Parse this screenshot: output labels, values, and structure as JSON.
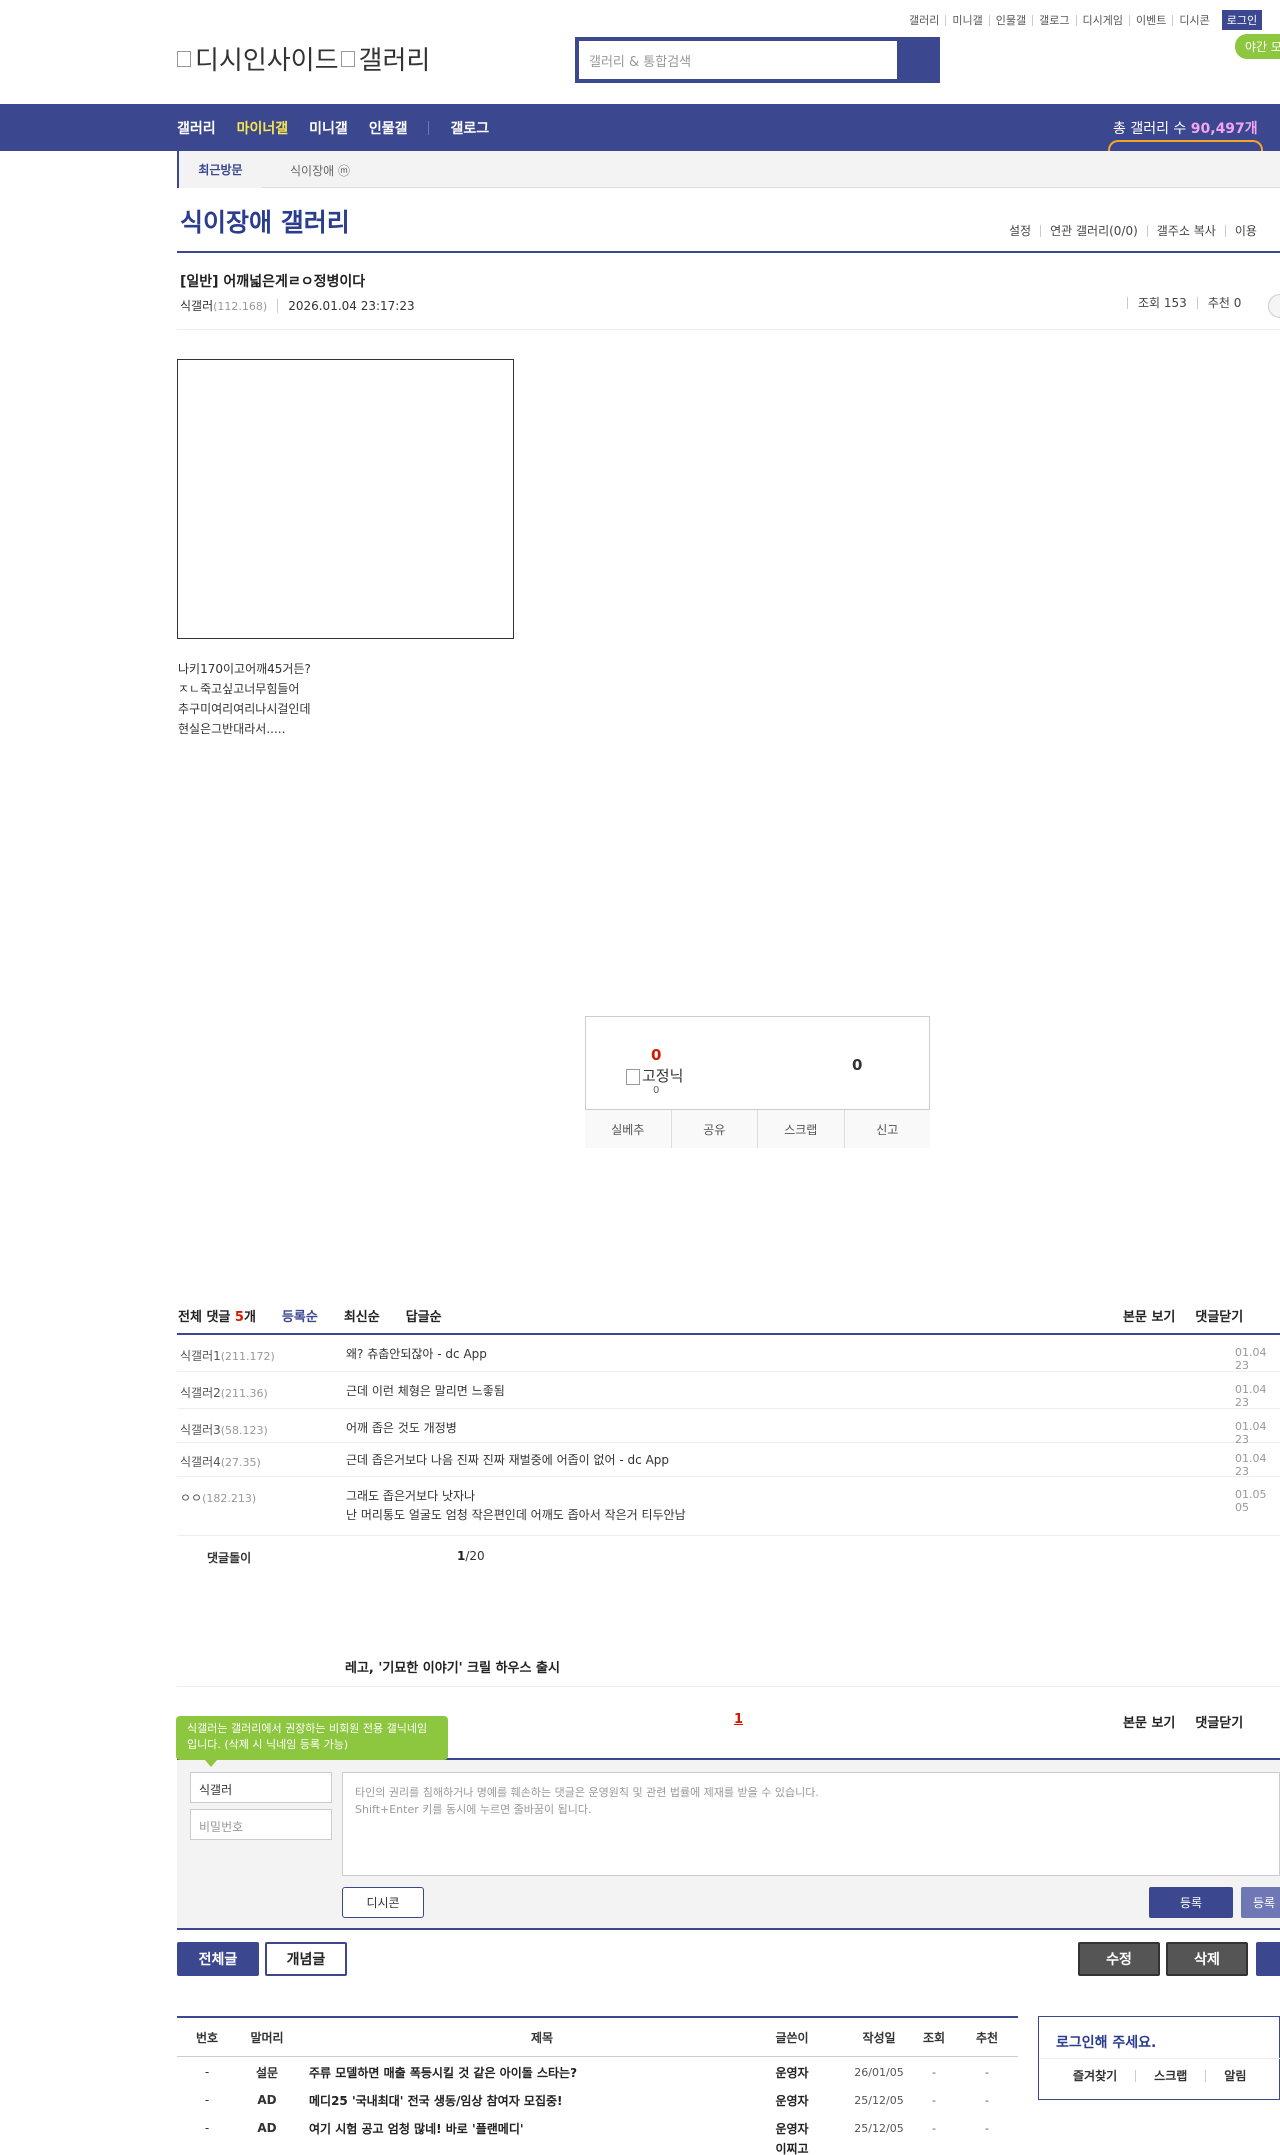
{
  "util_links": [
    "갤러리",
    "미니갤",
    "인물갤",
    "갤로그",
    "디시게임",
    "이벤트",
    "디시콘"
  ],
  "login_label": "로그인",
  "night_mode_label": "야간 모",
  "logo": {
    "part1": "디시인사이드",
    "part2": "갤러리"
  },
  "search": {
    "placeholder": "갤러리 & 통합검색"
  },
  "gnb": {
    "items": [
      "갤러리",
      "마이너갤",
      "미니갤",
      "인물갤",
      "갤로그"
    ],
    "active": "마이너갤"
  },
  "gall_count": {
    "label": "총 갤러리 수 ",
    "value": "90,497개"
  },
  "recent": {
    "tab": "최근방문",
    "item": "식이장애 ⓜ"
  },
  "gallery": {
    "title": "식이장애 갤러리",
    "links": [
      "설정",
      "연관 갤러리(0/0)",
      "갤주소 복사",
      "이용"
    ]
  },
  "post": {
    "subject": "[일반] 어깨넓은게ㄹㅇ정병이다",
    "writer": "식갤러",
    "ip": "(112.168)",
    "date": "2026.01.04 23:17:23",
    "views": "조회 153",
    "recommends": "추천 0",
    "body": [
      "나키170이고어깨45거든?",
      "ㅈㄴ죽고싶고너무힘들어",
      "추구미여리여리나시걸인데",
      "현실은그반대라서....."
    ]
  },
  "reco": {
    "up": "0",
    "fixed_label": "고정닉",
    "fixed_count": "0",
    "down": "0",
    "actions": [
      "실베추",
      "공유",
      "스크랩",
      "신고"
    ]
  },
  "comments": {
    "total_label": "전체 댓글 ",
    "total_count": "5",
    "total_unit": "개",
    "tabs": [
      "등록순",
      "최신순",
      "답글순"
    ],
    "right": [
      "본문 보기",
      "댓글닫기"
    ],
    "items": [
      {
        "name": "식갤러1",
        "ip": "(211.172)",
        "text": "왜? 츄춥안되잖아 - dc App",
        "date": "01.04 23"
      },
      {
        "name": "식갤러2",
        "ip": "(211.36)",
        "text": "근데 이런 체형은 말리면 느좋됨",
        "date": "01.04 23"
      },
      {
        "name": "식갤러3",
        "ip": "(58.123)",
        "text": "어깨 좁은 것도 개정병",
        "date": "01.04 23"
      },
      {
        "name": "식갤러4",
        "ip": "(27.35)",
        "text": "근데 좁은거보다 나음 진짜 진짜 재벌중에 어좁이 없어 - dc App",
        "date": "01.04 23"
      },
      {
        "name": "ㅇㅇ",
        "ip": "(182.213)",
        "text": "그래도 좁은거보다 낫자나",
        "text2": "난 머리통도 얼굴도 엄청 작은편인데 어깨도 좁아서 작은거 티두안남",
        "date": "01.05 05"
      }
    ],
    "dolgi": "댓글돌이",
    "page_current": "1",
    "page_total": "/20"
  },
  "ad_text": "레고, '기묘한 이야기' 크릴 하우스 출시",
  "pager_current": "1",
  "write": {
    "tooltip": "식갤러는 갤러리에서 권장하는 비회원 전용 갤닉네임입니다. (삭제 시 닉네임 등록 가능)",
    "nick": "식갤러",
    "pw_placeholder": "비밀번호",
    "notice1": "타인의 권리를 침해하거나 명예를 훼손하는 댓글은 운영원칙 및 관련 법률에 제재를 받을 수 있습니다.",
    "notice2": "Shift+Enter 키를 동시에 누르면 줄바꿈이 됩니다.",
    "dccon": "디시콘",
    "register": "등록",
    "register2": "등록"
  },
  "bottom_buttons": {
    "all": "전체글",
    "concept": "개념글",
    "edit": "수정",
    "delete": "삭제"
  },
  "list": {
    "headers": [
      "번호",
      "말머리",
      "제목",
      "글쓴이",
      "작성일",
      "조회",
      "추천"
    ],
    "rows": [
      {
        "num": "-",
        "head": "설문",
        "title": "주류 모델하면 매출 폭등시킬 것 같은 아이돌 스타는?",
        "writer": "운영자",
        "date": "26/01/05",
        "views": "-",
        "reco": "-"
      },
      {
        "num": "-",
        "head": "AD",
        "title": "메디25 '국내최대' 전국 생동/임상 참여자 모집중!",
        "writer": "운영자",
        "date": "25/12/05",
        "views": "-",
        "reco": "-"
      },
      {
        "num": "-",
        "head": "AD",
        "title": "여기 시험 공고 엄청 많네! 바로 '플랜메디'",
        "writer": "운영자",
        "date": "25/12/05",
        "views": "-",
        "reco": "-"
      },
      {
        "num": "",
        "head": "",
        "title": "",
        "writer": "이찌고",
        "date": "",
        "views": "",
        "reco": ""
      }
    ]
  },
  "login_box": {
    "title": "로그인해 주세요.",
    "links": [
      "즐겨찾기",
      "스크랩",
      "알림"
    ]
  }
}
